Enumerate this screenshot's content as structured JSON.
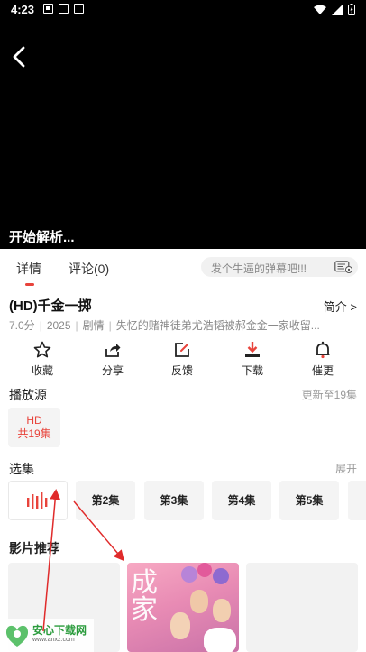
{
  "status_bar": {
    "time": "4:23"
  },
  "player": {
    "parse_text": "开始解析..."
  },
  "tabs": {
    "detail": "详情",
    "comments": "评论(0)"
  },
  "danmaku": {
    "placeholder": "发个牛逼的弹幕吧!!!"
  },
  "movie": {
    "title": "(HD)千金一掷",
    "intro_link": "简介 >",
    "score": "7.0分",
    "year": "2025",
    "genre": "剧情",
    "synopsis": "失忆的赌神徒弟尤浩韬被郝金金一家收留..."
  },
  "actions": [
    {
      "label": "收藏",
      "icon": "star-icon"
    },
    {
      "label": "分享",
      "icon": "share-icon"
    },
    {
      "label": "反馈",
      "icon": "edit-icon"
    },
    {
      "label": "下载",
      "icon": "download-icon"
    },
    {
      "label": "催更",
      "icon": "bell-icon"
    }
  ],
  "sources": {
    "label": "播放源",
    "update_text": "更新至19集",
    "items": [
      {
        "name": "HD",
        "count": "共19集"
      }
    ]
  },
  "episodes": {
    "label": "选集",
    "expand": "展开",
    "items": [
      "第2集",
      "第3集",
      "第4集",
      "第5集"
    ]
  },
  "recommendations": {
    "label": "影片推荐",
    "poster_text": "成家"
  },
  "watermark": {
    "name": "安心下载网",
    "url": "www.anxz.com"
  },
  "colors": {
    "accent": "#e8433b",
    "player_bg": "#000000"
  }
}
